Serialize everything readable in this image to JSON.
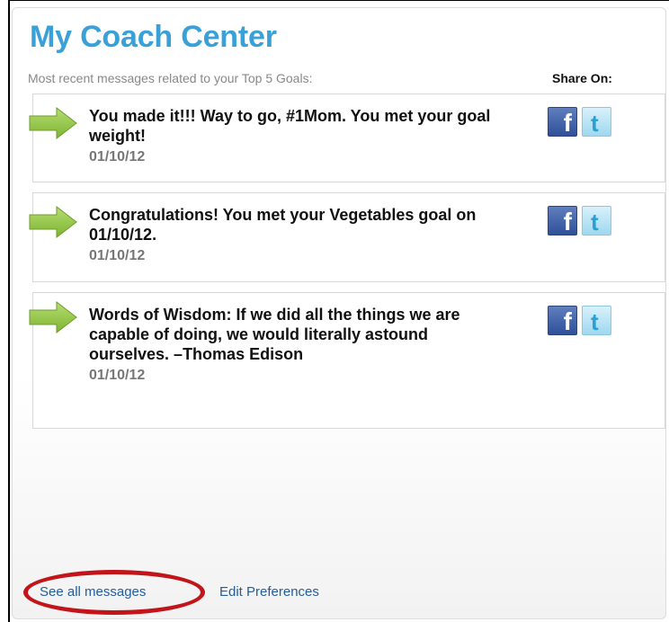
{
  "panel": {
    "title": "My Coach Center",
    "subtitle": "Most recent messages related to your Top 5 Goals:",
    "share_on_label": "Share On:"
  },
  "messages": [
    {
      "text": "You made it!!! Way to go, #1Mom. You met your goal weight!",
      "date": "01/10/12"
    },
    {
      "text": "Congratulations! You met your Vegetables goal on 01/10/12.",
      "date": "01/10/12"
    },
    {
      "text": "Words of Wisdom: If we did all the things we are capable of doing, we would literally astound ourselves. –Thomas Edison",
      "date": "01/10/12"
    }
  ],
  "icons": {
    "facebook_glyph": "f",
    "twitter_glyph": "t"
  },
  "footer": {
    "see_all_label": "See all messages",
    "edit_preferences_label": "Edit Preferences"
  },
  "colors": {
    "title": "#3aa0d8",
    "link": "#245d9c",
    "highlight": "#c1151a",
    "arrow": "#8dc63f"
  }
}
